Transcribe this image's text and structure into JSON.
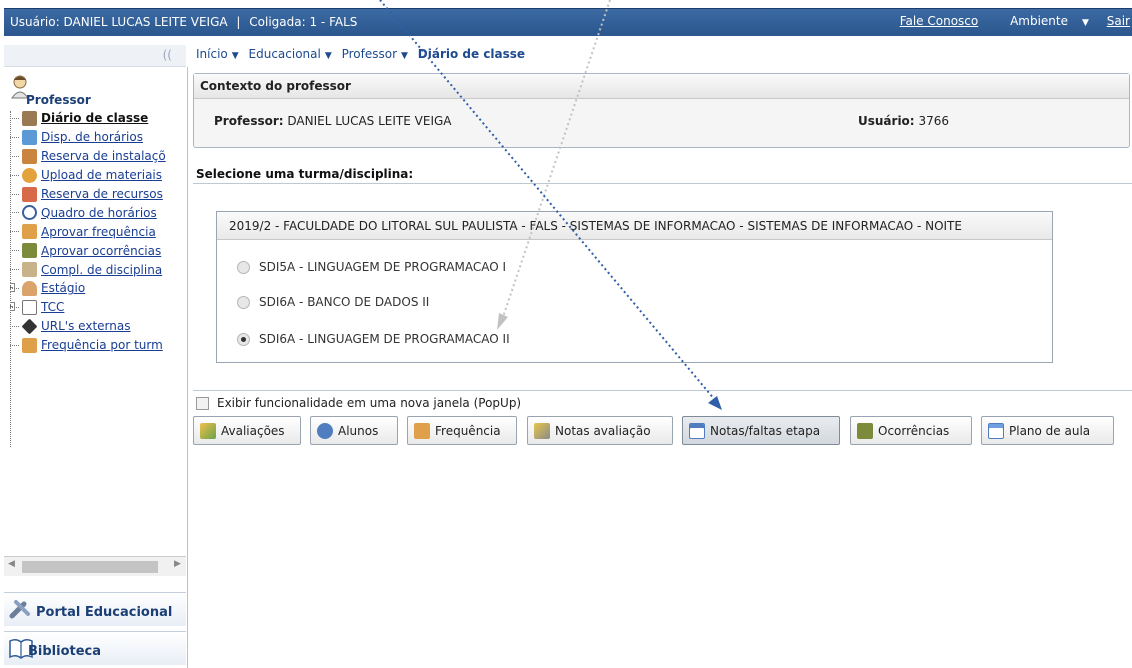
{
  "topbar": {
    "user_label": "Usuário:",
    "user_name": "DANIEL LUCAS LEITE VEIGA",
    "coligada": "Coligada: 1 - FALS",
    "separator": "|",
    "contact": "Fale Conosco",
    "ambiente": "Ambiente",
    "sair": "Sair"
  },
  "breadcrumb": {
    "collapse": "((",
    "items": [
      "Início",
      "Educacional",
      "Professor"
    ],
    "current": "Diário de classe"
  },
  "sidebar": {
    "title": "Professor",
    "items": [
      {
        "label": "Diário de classe",
        "icon": "book-icon"
      },
      {
        "label": "Disp. de horários",
        "icon": "calendar-icon"
      },
      {
        "label": "Reserva de instalaçõ",
        "icon": "building-icon"
      },
      {
        "label": "Upload de materiais",
        "icon": "upload-icon"
      },
      {
        "label": "Reserva de recursos",
        "icon": "checklist-icon"
      },
      {
        "label": "Quadro de horários",
        "icon": "clock-icon"
      },
      {
        "label": "Aprovar frequência",
        "icon": "attendance-icon"
      },
      {
        "label": "Aprovar ocorrências",
        "icon": "pen-icon"
      },
      {
        "label": "Compl. de disciplina",
        "icon": "document-icon"
      },
      {
        "label": "Estágio",
        "icon": "person-icon"
      },
      {
        "label": "TCC",
        "icon": "page-icon"
      },
      {
        "label": "URL's externas",
        "icon": "link-icon"
      },
      {
        "label": "Frequência por turm",
        "icon": "attendance-icon"
      }
    ],
    "panels": {
      "portal": "Portal Educacional",
      "biblioteca": "Biblioteca"
    }
  },
  "contexto": {
    "title": "Contexto do professor",
    "professor_label": "Professor:",
    "professor_value": "DANIEL LUCAS LEITE VEIGA",
    "usuario_label": "Usuário:",
    "usuario_value": "3766"
  },
  "selecao": {
    "title": "Selecione uma turma/disciplina:",
    "turma": "2019/2 - FACULDADE DO LITORAL SUL PAULISTA - FALS - SISTEMAS DE INFORMACAO - SISTEMAS DE INFORMACAO - NOITE",
    "disciplinas": [
      {
        "label": "SDI5A - LINGUAGEM DE PROGRAMACAO I",
        "checked": false
      },
      {
        "label": "SDI6A - BANCO DE DADOS II",
        "checked": false
      },
      {
        "label": "SDI6A - LINGUAGEM DE PROGRAMACAO II",
        "checked": true
      }
    ]
  },
  "popup": {
    "label": "Exibir funcionalidade em uma nova janela (PopUp)",
    "checked": false
  },
  "actions": {
    "avaliacoes": "Avaliações",
    "alunos": "Alunos",
    "frequencia": "Frequência",
    "notas_avaliacao": "Notas avaliação",
    "notas_faltas_etapa": "Notas/faltas etapa",
    "ocorrencias": "Ocorrências",
    "plano_de_aula": "Plano de aula",
    "active": "notas_faltas_etapa"
  },
  "colors": {
    "topbar": "#2f5b95",
    "link": "#1a3e93",
    "arrow_blue": "#2e5fa8",
    "arrow_gray": "#bdbdbd"
  }
}
